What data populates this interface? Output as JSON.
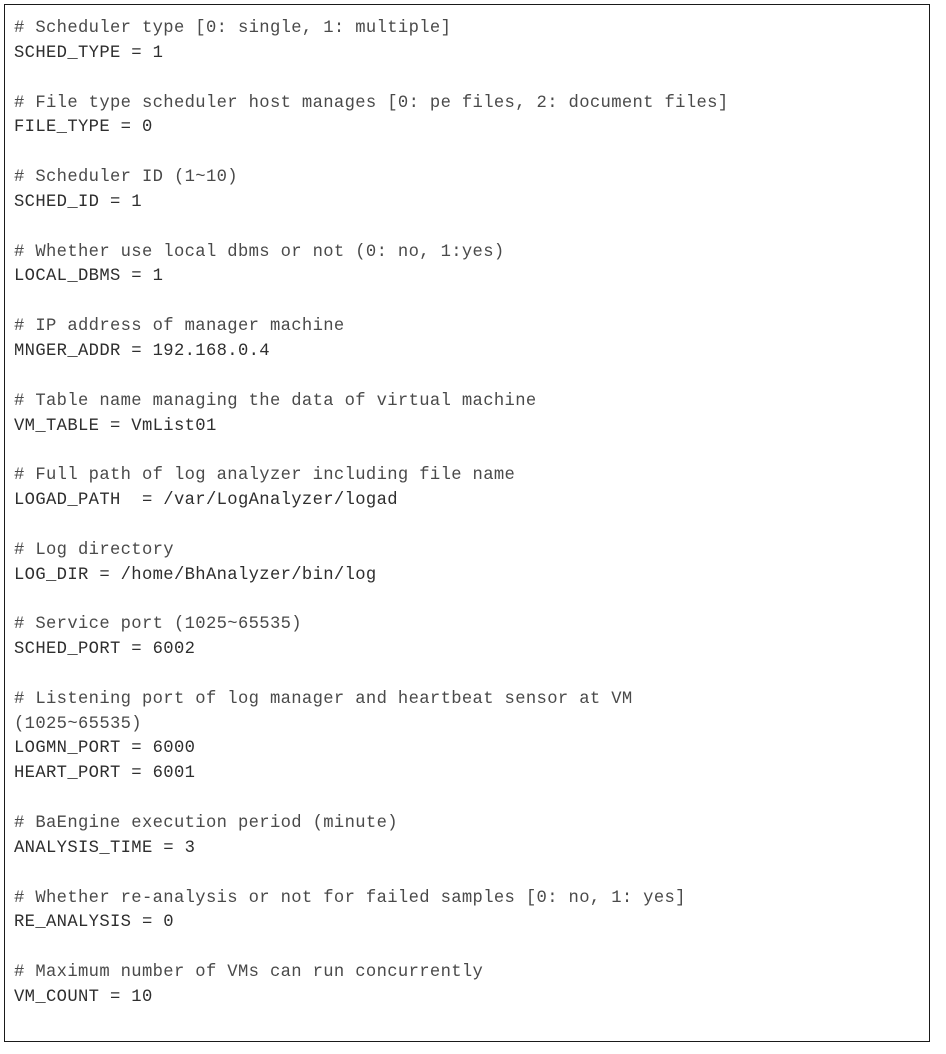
{
  "document": {
    "kind": "configuration-file",
    "border_color": "#1a1a1a",
    "background_color": "#ffffff",
    "comment_color": "#4a4a4a",
    "assignment_color": "#2e2e2e"
  },
  "lines": [
    {
      "type": "comment",
      "text": "# Scheduler type [0: single, 1: multiple]"
    },
    {
      "type": "assignment",
      "text": "SCHED_TYPE = 1"
    },
    {
      "type": "blank",
      "text": ""
    },
    {
      "type": "comment",
      "text": "# File type scheduler host manages [0: pe files, 2: document files]"
    },
    {
      "type": "assignment",
      "text": "FILE_TYPE = 0"
    },
    {
      "type": "blank",
      "text": ""
    },
    {
      "type": "comment",
      "text": "# Scheduler ID (1~10)"
    },
    {
      "type": "assignment",
      "text": "SCHED_ID = 1"
    },
    {
      "type": "blank",
      "text": ""
    },
    {
      "type": "comment",
      "text": "# Whether use local dbms or not (0: no, 1:yes)"
    },
    {
      "type": "assignment",
      "text": "LOCAL_DBMS = 1"
    },
    {
      "type": "blank",
      "text": ""
    },
    {
      "type": "comment",
      "text": "# IP address of manager machine"
    },
    {
      "type": "assignment",
      "text": "MNGER_ADDR = 192.168.0.4"
    },
    {
      "type": "blank",
      "text": ""
    },
    {
      "type": "comment",
      "text": "# Table name managing the data of virtual machine"
    },
    {
      "type": "assignment",
      "text": "VM_TABLE = VmList01"
    },
    {
      "type": "blank",
      "text": ""
    },
    {
      "type": "comment",
      "text": "# Full path of log analyzer including file name"
    },
    {
      "type": "assignment",
      "text": "LOGAD_PATH  = /var/LogAnalyzer/logad"
    },
    {
      "type": "blank",
      "text": ""
    },
    {
      "type": "comment",
      "text": "# Log directory"
    },
    {
      "type": "assignment",
      "text": "LOG_DIR = /home/BhAnalyzer/bin/log"
    },
    {
      "type": "blank",
      "text": ""
    },
    {
      "type": "comment",
      "text": "# Service port (1025~65535)"
    },
    {
      "type": "assignment",
      "text": "SCHED_PORT = 6002"
    },
    {
      "type": "blank",
      "text": ""
    },
    {
      "type": "comment",
      "text": "# Listening port of log manager and heartbeat sensor at VM"
    },
    {
      "type": "comment",
      "text": "(1025~65535)"
    },
    {
      "type": "assignment",
      "text": "LOGMN_PORT = 6000"
    },
    {
      "type": "assignment",
      "text": "HEART_PORT = 6001"
    },
    {
      "type": "blank",
      "text": ""
    },
    {
      "type": "comment",
      "text": "# BaEngine execution period (minute)"
    },
    {
      "type": "assignment",
      "text": "ANALYSIS_TIME = 3"
    },
    {
      "type": "blank",
      "text": ""
    },
    {
      "type": "comment",
      "text": "# Whether re-analysis or not for failed samples [0: no, 1: yes]"
    },
    {
      "type": "assignment",
      "text": "RE_ANALYSIS = 0"
    },
    {
      "type": "blank",
      "text": ""
    },
    {
      "type": "comment",
      "text": "# Maximum number of VMs can run concurrently"
    },
    {
      "type": "assignment",
      "text": "VM_COUNT = 10"
    }
  ],
  "settings": [
    {
      "key": "SCHED_TYPE",
      "value": "1",
      "comment": "Scheduler type [0: single, 1: multiple]"
    },
    {
      "key": "FILE_TYPE",
      "value": "0",
      "comment": "File type scheduler host manages [0: pe files, 2: document files]"
    },
    {
      "key": "SCHED_ID",
      "value": "1",
      "comment": "Scheduler ID (1~10)"
    },
    {
      "key": "LOCAL_DBMS",
      "value": "1",
      "comment": "Whether use local dbms or not (0: no, 1:yes)"
    },
    {
      "key": "MNGER_ADDR",
      "value": "192.168.0.4",
      "comment": "IP address of manager machine"
    },
    {
      "key": "VM_TABLE",
      "value": "VmList01",
      "comment": "Table name managing the data of virtual machine"
    },
    {
      "key": "LOGAD_PATH",
      "value": "/var/LogAnalyzer/logad",
      "comment": "Full path of log analyzer including file name"
    },
    {
      "key": "LOG_DIR",
      "value": "/home/BhAnalyzer/bin/log",
      "comment": "Log directory"
    },
    {
      "key": "SCHED_PORT",
      "value": "6002",
      "comment": "Service port (1025~65535)"
    },
    {
      "key": "LOGMN_PORT",
      "value": "6000",
      "comment": "Listening port of log manager and heartbeat sensor at VM (1025~65535)"
    },
    {
      "key": "HEART_PORT",
      "value": "6001",
      "comment": "Listening port of log manager and heartbeat sensor at VM (1025~65535)"
    },
    {
      "key": "ANALYSIS_TIME",
      "value": "3",
      "comment": "BaEngine execution period (minute)"
    },
    {
      "key": "RE_ANALYSIS",
      "value": "0",
      "comment": "Whether re-analysis or not for failed samples [0: no, 1: yes]"
    },
    {
      "key": "VM_COUNT",
      "value": "10",
      "comment": "Maximum number of VMs can run concurrently"
    }
  ]
}
